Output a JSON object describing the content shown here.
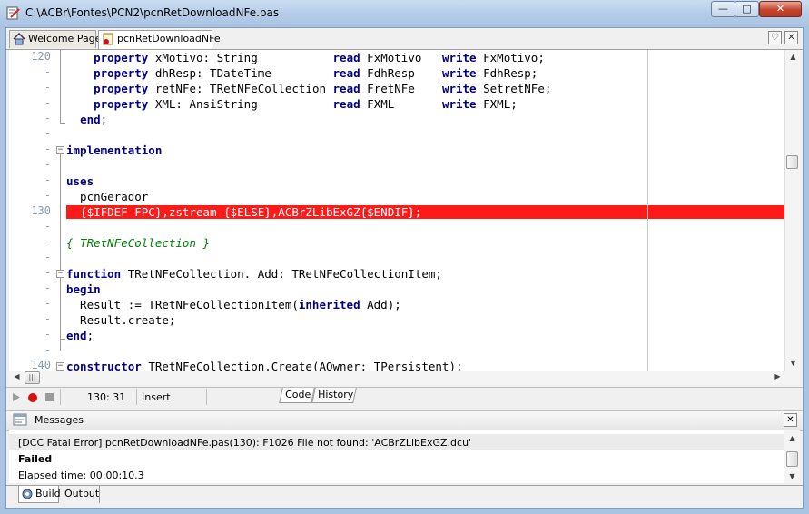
{
  "window": {
    "title": "C:\\ACBr\\Fontes\\PCN2\\pcnRetDownloadNFe.pas",
    "min_glyph": "—",
    "max_glyph": "□",
    "close_glyph": "✕"
  },
  "tabs": [
    {
      "label": "Welcome Page",
      "active": false
    },
    {
      "label": "pcnRetDownloadNFe",
      "active": true
    }
  ],
  "tab_buttons": {
    "list_glyph": "♡",
    "close_glyph": "✕"
  },
  "editor": {
    "gutter": [
      "120",
      "-",
      "-",
      "-",
      "-",
      "-",
      "-",
      "-",
      "-",
      "-",
      "130",
      "-",
      "-",
      "-",
      "-",
      "-",
      "-",
      "-",
      "-",
      "-",
      "140"
    ],
    "lines": [
      "    property xMotivo: String           read FxMotivo   write FxMotivo;",
      "    property dhResp: TDateTime         read FdhResp    write FdhResp;",
      "    property retNFe: TRetNFeCollection read FretNFe    write SetretNFe;",
      "    property XML: AnsiString           read FXML       write FXML;",
      "  end;",
      "",
      "implementation",
      "",
      "uses",
      "  pcnGerador",
      "  {$IFDEF FPC},zstream {$ELSE},ACBrZLibExGZ{$ENDIF};",
      "",
      "{ TRetNFeCollection }",
      "",
      "function TRetNFeCollection. Add: TRetNFeCollectionItem;",
      "begin",
      "  Result := TRetNFeCollectionItem(inherited Add);",
      "  Result.create;",
      "end;",
      "",
      "constructor TRetNFeCollection.Create(AOwner: TPersistent);"
    ],
    "error_line_index": 10,
    "error_color": "#ff1a1a"
  },
  "status": {
    "position": "130:  31",
    "mode": "Insert",
    "view_tabs": [
      "Code",
      "History"
    ]
  },
  "messages": {
    "title": "Messages",
    "close_glyph": "✕",
    "items": [
      "[DCC Fatal Error] pcnRetDownloadNFe.pas(130): F1026 File not found: 'ACBrZLibExGZ.dcu'",
      "Failed",
      "Elapsed time: 00:00:10.3"
    ]
  },
  "bottom_tabs": [
    "Build",
    "Output"
  ]
}
